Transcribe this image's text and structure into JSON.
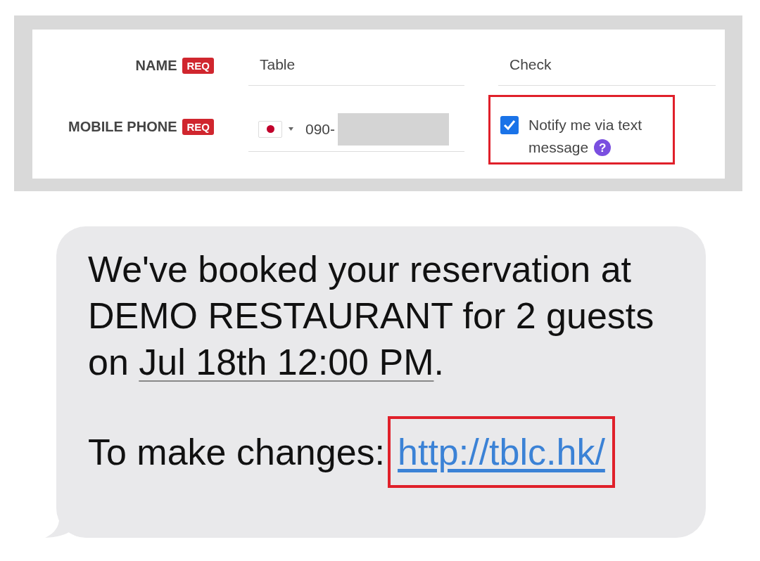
{
  "form": {
    "rows": [
      {
        "label": "NAME",
        "badge": "REQ",
        "kind": "name",
        "fields": [
          {
            "value": "Table"
          },
          {
            "value": "Check"
          }
        ]
      },
      {
        "label": "MOBILE PHONE",
        "badge": "REQ",
        "kind": "phone",
        "phone_value": "090-",
        "notify": {
          "label_lines": [
            "Notify me via text",
            "message"
          ],
          "checked": true,
          "help": "?",
          "highlighted": true
        }
      }
    ]
  },
  "message": {
    "text_before": "We've booked your reservation at DEMO RESTAURANT for 2 guests on",
    "date": "Jul 18th 12:00 PM",
    "text_after": ".",
    "changes_label": "To make changes:",
    "link": "http://tblc.hk/",
    "link_highlighted": true
  }
}
